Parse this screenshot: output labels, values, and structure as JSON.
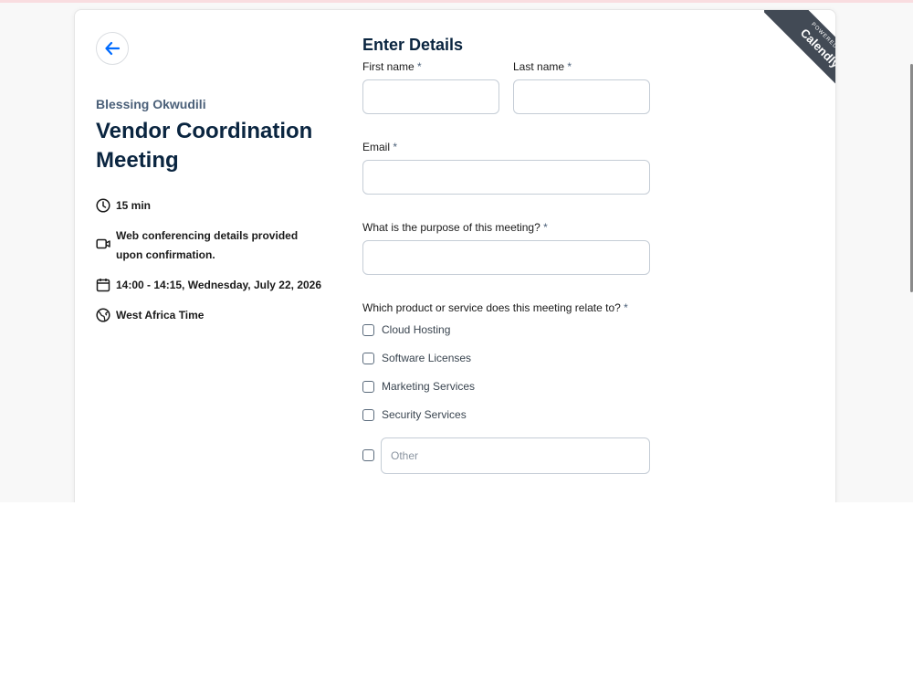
{
  "colors": {
    "accent": "#006bff",
    "title": "#0a2540",
    "muted": "#4b6079",
    "ribbon": "#424a55"
  },
  "host": {
    "name": "Blessing Okwudili"
  },
  "event": {
    "title": "Vendor Coordination Meeting",
    "duration": "15 min",
    "location": "Web conferencing details provided upon confirmation.",
    "datetime": "14:00 - 14:15, Wednesday, July 22, 2026",
    "timezone": "West Africa Time"
  },
  "form": {
    "heading": "Enter Details",
    "first_name_label": "First name",
    "last_name_label": "Last name",
    "email_label": "Email",
    "purpose_label": "What is the purpose of this meeting?",
    "product_label": "Which product or service does this meeting relate to?",
    "required_mark": "*",
    "options": [
      "Cloud Hosting",
      "Software Licenses",
      "Marketing Services",
      "Security Services"
    ],
    "other_placeholder": "Other"
  },
  "ribbon": {
    "small": "POWERED BY",
    "brand": "Calendly"
  },
  "icons": {
    "back": "arrow-left-icon",
    "duration": "clock-icon",
    "location": "video-camera-icon",
    "date": "calendar-icon",
    "timezone": "globe-icon"
  }
}
